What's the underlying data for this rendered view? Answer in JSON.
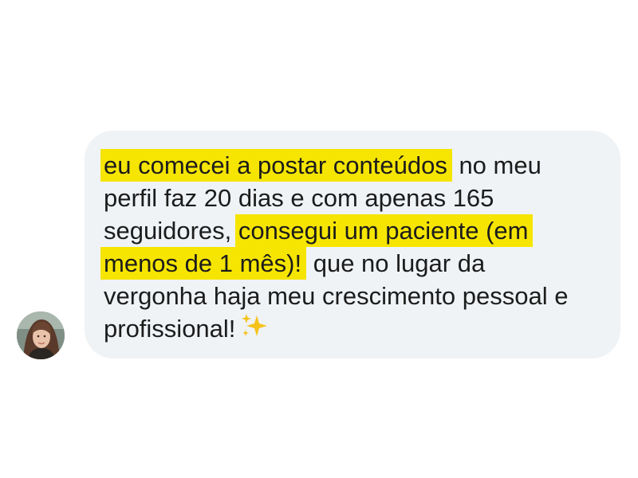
{
  "message": {
    "line1_highlight": "eu comecei a postar conteúdos",
    "line1_rest": " no meu",
    "line2": "perfil faz 20 dias e com apenas 165",
    "line3_start": "seguidores, ",
    "line3_highlight": "consegui um paciente (em",
    "line4_highlight": "menos de 1 mês)!",
    "line4_rest": " que no lugar da",
    "line5": "vergonha haja meu crescimento pessoal e",
    "line6": "profissional!"
  },
  "colors": {
    "highlight": "#f6e500",
    "bubble": "#eff3f6",
    "text": "#1c1c1c"
  },
  "icons": {
    "sender_avatar": "avatar",
    "emoji": "sparkles-icon"
  }
}
